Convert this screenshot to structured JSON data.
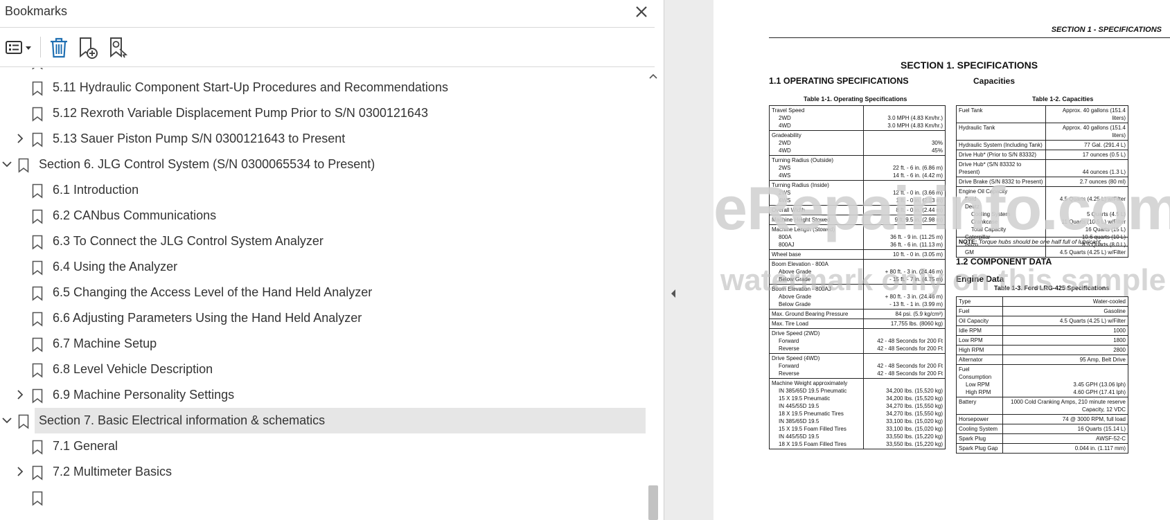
{
  "panel": {
    "title": "Bookmarks",
    "icons": {
      "close": "close-icon",
      "options": "list-options-icon",
      "delete": "trash-icon",
      "add": "add-bookmark-icon",
      "find": "find-bookmark-icon"
    }
  },
  "bookmarks": [
    {
      "label": "5.11 Hydraulic Component Start-Up Procedures and Recommendations"
    },
    {
      "label": "5.12 Rexroth Variable Displacement Pump Prior to S/N 0300121643"
    },
    {
      "label": "5.13 Sauer Piston Pump S/N 0300121643 to Present"
    },
    {
      "label": "Section 6. JLG Control System (S/N 0300065534 to Present)"
    },
    {
      "label": "6.1 Introduction"
    },
    {
      "label": "6.2 CANbus Communications"
    },
    {
      "label": "6.3 To Connect the JLG Control System Analyzer"
    },
    {
      "label": "6.4 Using the Analyzer"
    },
    {
      "label": "6.5 Changing the Access Level of the Hand Held Analyzer"
    },
    {
      "label": "6.6 Adjusting Parameters Using the Hand Held Analyzer"
    },
    {
      "label": "6.7 Machine Setup"
    },
    {
      "label": "6.8 Level Vehicle Description"
    },
    {
      "label": "6.9 Machine Personality Settings"
    },
    {
      "label": "Section 7. Basic Electrical information & schematics"
    },
    {
      "label": "7.1 General"
    },
    {
      "label": "7.2 Multimeter Basics"
    }
  ],
  "doc": {
    "header": "SECTION 1 - SPECIFICATIONS",
    "title": "SECTION 1.  SPECIFICATIONS",
    "h_operating": "1.1     OPERATING SPECIFICATIONS",
    "h_capacities": "Capacities",
    "cap_t1": "Table 1-1. Operating Specifications",
    "cap_t2": "Table 1-2. Capacities",
    "h_component": "1.2     COMPONENT DATA",
    "h_engine": "Engine Data",
    "cap_t3": "Table 1-3. Ford LRG-425 Specifications",
    "note_label": "NOTE:",
    "note_text": " Torque hubs should be one half full of lubricant.",
    "watermark1": "eRepairinfo.com",
    "watermark2": "watermark only on this sample",
    "t1": {
      "travel": "Travel Speed",
      "travel_2wd": "2WD",
      "travel_4wd": "4WD",
      "travel_2wd_v": "3.0 MPH (4.83 Km/hr.)",
      "travel_4wd_v": "3.0 MPH (4.83 Km/hr.)",
      "grade": "Gradeability",
      "grade_2wd": "2WD",
      "grade_4wd": "4WD",
      "grade_2wd_v": "30%",
      "grade_4wd_v": "45%",
      "tro": "Turning Radius (Outside)",
      "tro_2ws": "2WS",
      "tro_4ws": "4WS",
      "tro_2ws_v": "22 ft. - 6 in. (6.86 m)",
      "tro_4ws_v": "14 ft. - 6 in. (4.42 m)",
      "tri": "Turning Radius (Inside)",
      "tri_2ws": "2WS",
      "tri_4ws": "4WS",
      "tri_2ws_v": "12 ft. - 0 in. (3.66 m)",
      "tri_4ws_v": "1 ft. - 0 in. (2.13 m)",
      "width": "Overall Width",
      "width_v": "8 ft. - 0 in. (2.44 m)",
      "height": "Machine Height Stowed",
      "height_v": "9 ft. 9.5 in. (2.98 m)",
      "length": "Machine Length (Stowed)",
      "len_800a": "800A",
      "len_800aj": "800AJ",
      "len_800a_v": "36 ft. - 9 in. (11.25 m)",
      "len_800aj_v": "36 ft. - 6 in. (11.13 m)",
      "wheelbase": "Wheel base",
      "wheelbase_v": "10 ft. - 0 in. (3.05 m)",
      "be800a": "Boom Elevation - 800A",
      "be800a_above": "Above Grade",
      "be800a_below": "Below Grade",
      "be800a_above_v": "+ 80 ft. - 3 in. (24.46 m)",
      "be800a_below_v": "- 15 ft. - 7 in. (4.75 m)",
      "be800aj": "Boom Elevation - 800AJ",
      "be800aj_above": "Above Grade",
      "be800aj_below": "Below Grade",
      "be800aj_above_v": "+ 80 ft. - 3 in. (24.46 m)",
      "be800aj_below_v": "- 13 ft. - 1 in. (3.99 m)",
      "gbp": "Max. Ground Bearing Pressure",
      "gbp_v": "84 psi. (5.9 kg/cm²)",
      "tire": "Max. Tire Load",
      "tire_v": "17,755 lbs. (8060 kg)",
      "ds2": "Drive Speed (2WD)",
      "ds2_f": "Forward",
      "ds2_r": "Reverse",
      "ds2_f_v": "42 - 48 Seconds for 200 Ft",
      "ds2_r_v": "42 - 48 Seconds for 200 Ft",
      "ds4": "Drive Speed (4WD)",
      "ds4_f": "Forward",
      "ds4_r": "Reverse",
      "ds4_f_v": "42 - 48 Seconds for 200 Ft",
      "ds4_r_v": "42 - 48 Seconds for 200 Ft",
      "mw": "Machine Weight approximately",
      "mw_rows": [
        {
          "k": "IN 385/65D 19.5 Pneumatic",
          "v": "34,200 lbs. (15,520 kg)"
        },
        {
          "k": "15 X 19.5 Pneumatic",
          "v": "34,200 lbs. (15,520 kg)"
        },
        {
          "k": "IN 445/55D 19.5",
          "v": "34,270 lbs. (15,550 kg)"
        },
        {
          "k": "18 X 19.5 Pneumatic Tires",
          "v": "34,270 lbs. (15,550 kg)"
        },
        {
          "k": "IN 385/65D 19.5",
          "v": "33,100 lbs. (15,020 kg)"
        },
        {
          "k": "15 X 19.5 Foam Filled Tires",
          "v": "33,100 lbs. (15,020 kg)"
        },
        {
          "k": "IN 445/55D 19.5",
          "v": "33,550 lbs. (15,220 kg)"
        },
        {
          "k": "18 X 19.5 Foam Filled Tires",
          "v": "33,550 lbs. (15,220 kg)"
        }
      ]
    },
    "t2": [
      {
        "k": "Fuel Tank",
        "v": "Approx. 40 gallons (151.4 liters)"
      },
      {
        "k": "Hydraulic Tank",
        "v": "Approx. 40 gallons (151.4 liters)"
      },
      {
        "k": "Hydraulic System (Including Tank)",
        "v": "77 Gal. (291.4 L)"
      },
      {
        "k": "Drive Hub* (Prior to S/N 83332)",
        "v": "17 ounces (0.5 L)"
      },
      {
        "k": "Drive Hub* (S/N 83332 to Present)",
        "v": "44 ounces (1.3 L)"
      },
      {
        "k": "Drive Brake (S/N 8332 to Present)",
        "v": "2.7 ounces (80 ml)"
      }
    ],
    "t2_oil": {
      "title": "Engine Oil Capacity",
      "rows": [
        {
          "k": "Ford",
          "v": "4.5 Quarts (4.25 L) w/Filter",
          "i": 1
        },
        {
          "k": "Deutz",
          "v": "",
          "i": 1
        },
        {
          "k": "Cooling System",
          "v": "5 Quarts (4.5 L)",
          "i": 2
        },
        {
          "k": "Crankcase",
          "v": "11 Quarts (10.5 L) w/Filter",
          "i": 2
        },
        {
          "k": "Total Capacity",
          "v": "16 Quarts (15 L)",
          "i": 2
        },
        {
          "k": "Caterpillar",
          "v": "10.6 quarts (10 L)",
          "i": 1
        },
        {
          "k": "Isuzu",
          "v": "8.5 Quarts (8.0 L)",
          "i": 1
        },
        {
          "k": "GM",
          "v": "4.5 Quarts (4.25 L) w/Filter",
          "i": 1
        }
      ]
    },
    "t3": [
      {
        "k": "Type",
        "v": "Water-cooled"
      },
      {
        "k": "Fuel",
        "v": "Gasoline"
      },
      {
        "k": "Oil Capacity",
        "v": "4.5 Quarts (4.25 L) w/Filter"
      },
      {
        "k": "Idle RPM",
        "v": "1000"
      },
      {
        "k": "Low RPM",
        "v": "1800"
      },
      {
        "k": "High RPM",
        "v": "2800"
      },
      {
        "k": "Alternator",
        "v": "95 Amp, Belt Drive"
      }
    ],
    "t3_fuel": {
      "k": "Fuel Consumption",
      "low": "Low RPM",
      "high": "High RPM",
      "low_v": "3.45 GPH (13.06 lph)",
      "high_v": "4.60 GPH (17.41 lph)"
    },
    "t3_b": [
      {
        "k": "Battery",
        "v": "1000 Cold Cranking Amps, 210 minute reserve Capacity, 12 VDC"
      },
      {
        "k": "Horsepower",
        "v": "74 @ 3000 RPM, full load"
      },
      {
        "k": "Cooling System",
        "v": "16 Quarts (15.14 L)"
      },
      {
        "k": "Spark Plug",
        "v": "AWSF-52-C"
      },
      {
        "k": "Spark Plug Gap",
        "v": "0.044 in. (1.117 mm)"
      }
    ]
  }
}
